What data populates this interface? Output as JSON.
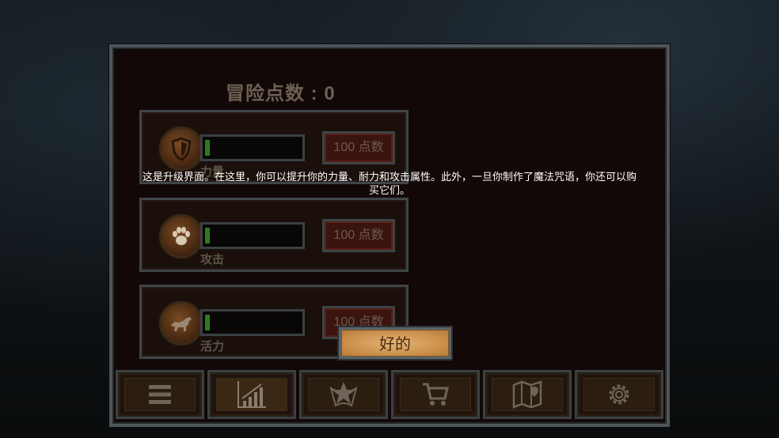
{
  "header": {
    "points_label": "冒险点数 : 0"
  },
  "stats": [
    {
      "label": "力量",
      "cost": "100 点数",
      "icon": "shield-icon"
    },
    {
      "label": "攻击",
      "cost": "100 点数",
      "icon": "paw-icon"
    },
    {
      "label": "活力",
      "cost": "100 点数",
      "icon": "wolf-icon"
    }
  ],
  "tutorial": {
    "line1": "这是升级界面。在这里，你可以提升你的力量、耐力和攻击属性。此外，一旦你制作了魔法咒语，你还可以购",
    "line2": "买它们。",
    "ok_label": "好的"
  },
  "nav": [
    {
      "icon": "menu-icon"
    },
    {
      "icon": "stats-chart-icon"
    },
    {
      "icon": "spell-icon"
    },
    {
      "icon": "cart-icon"
    },
    {
      "icon": "map-icon"
    },
    {
      "icon": "gear-icon"
    }
  ],
  "colors": {
    "accent_gold": "#d9a461",
    "bar_green": "#2f7a1f",
    "cost_red": "#3b1410"
  }
}
